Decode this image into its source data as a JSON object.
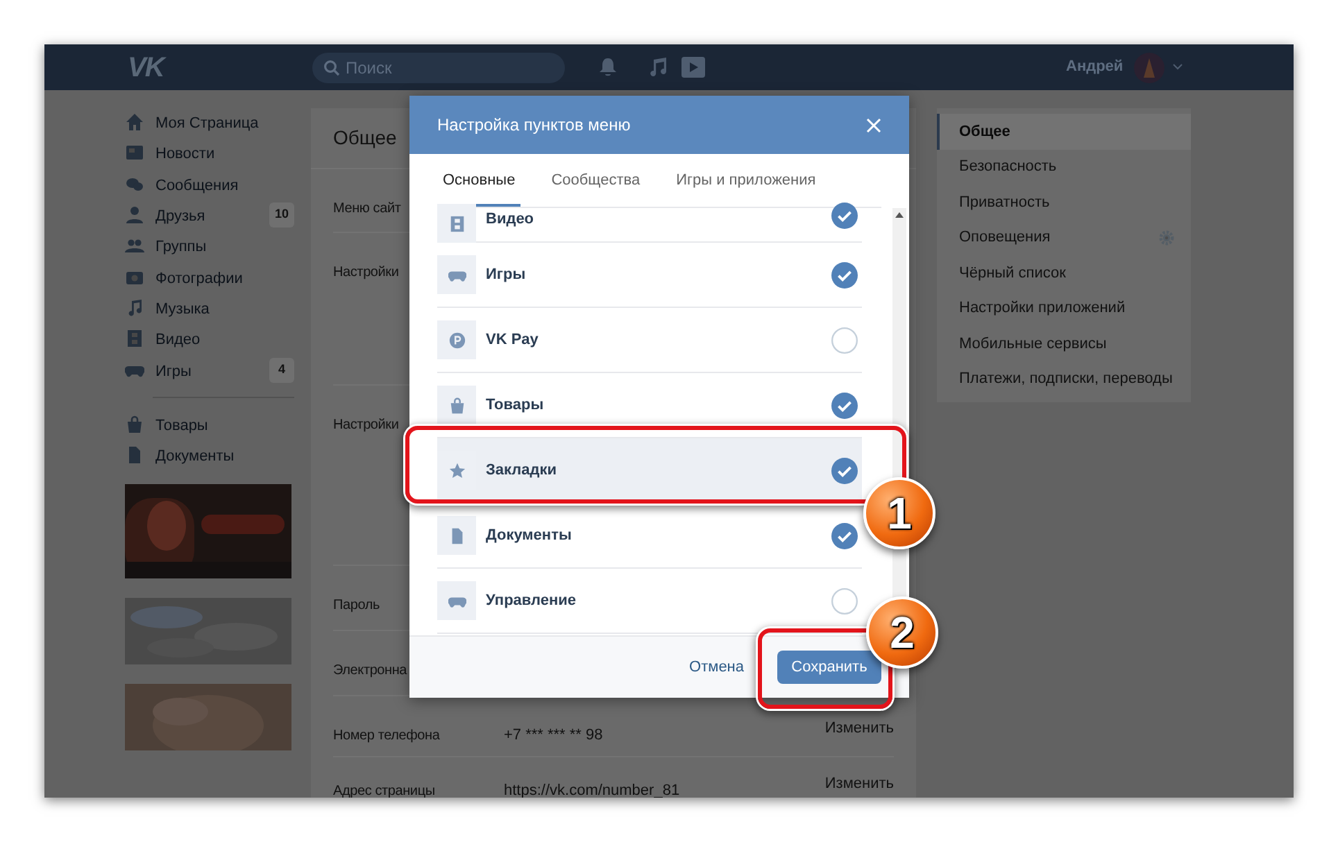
{
  "header": {
    "logo": "VK",
    "search": {
      "placeholder": "Поиск"
    },
    "user": {
      "name": "Андрей"
    }
  },
  "left_menu": [
    {
      "label": "Моя Страница"
    },
    {
      "label": "Новости"
    },
    {
      "label": "Сообщения"
    },
    {
      "label": "Друзья",
      "badge": "10"
    },
    {
      "label": "Группы"
    },
    {
      "label": "Фотографии"
    },
    {
      "label": "Музыка"
    },
    {
      "label": "Видео"
    },
    {
      "label": "Игры",
      "badge": "4"
    }
  ],
  "left_menu_extra": [
    {
      "label": "Товары"
    },
    {
      "label": "Документы"
    }
  ],
  "settings": {
    "title": "Общее",
    "rows": [
      {
        "label": "Меню сайт"
      },
      {
        "label": "Настройки"
      },
      {
        "label": "Настройки"
      },
      {
        "label": "Пароль"
      },
      {
        "label": "Электронна"
      },
      {
        "label": "Номер телефона",
        "value": "+7 *** *** ** 98",
        "action": "Изменить"
      },
      {
        "label": "Адрес страницы",
        "value": "https://vk.com/number_81",
        "action": "Изменить"
      }
    ]
  },
  "right_menu": [
    {
      "label": "Общее",
      "selected": true
    },
    {
      "label": "Безопасность",
      "selected": false
    },
    {
      "label": "Приватность",
      "selected": false
    },
    {
      "label": "Оповещения",
      "selected": false
    },
    {
      "label": "Чёрный список",
      "selected": false
    },
    {
      "label": "Настройки приложений",
      "selected": false
    },
    {
      "label": "Мобильные сервисы",
      "selected": false
    },
    {
      "label": "Платежи, подписки, переводы",
      "selected": false
    }
  ],
  "modal": {
    "title": "Настройка пунктов меню",
    "tabs": [
      {
        "label": "Основные",
        "selected": true
      },
      {
        "label": "Сообщества",
        "selected": false
      },
      {
        "label": "Игры и приложения",
        "selected": false
      }
    ],
    "items": [
      {
        "label": "Видео",
        "checked": true,
        "highlighted": false
      },
      {
        "label": "Игры",
        "checked": true,
        "highlighted": false
      },
      {
        "label": "VK Pay",
        "checked": false,
        "highlighted": false
      },
      {
        "label": "Товары",
        "checked": true,
        "highlighted": false
      },
      {
        "label": "Закладки",
        "checked": true,
        "highlighted": true
      },
      {
        "label": "Документы",
        "checked": true,
        "highlighted": false
      },
      {
        "label": "Управление",
        "checked": false,
        "highlighted": false
      }
    ],
    "cancel": "Отмена",
    "save": "Сохранить"
  },
  "annotations": [
    {
      "label": "1"
    },
    {
      "label": "2"
    }
  ]
}
